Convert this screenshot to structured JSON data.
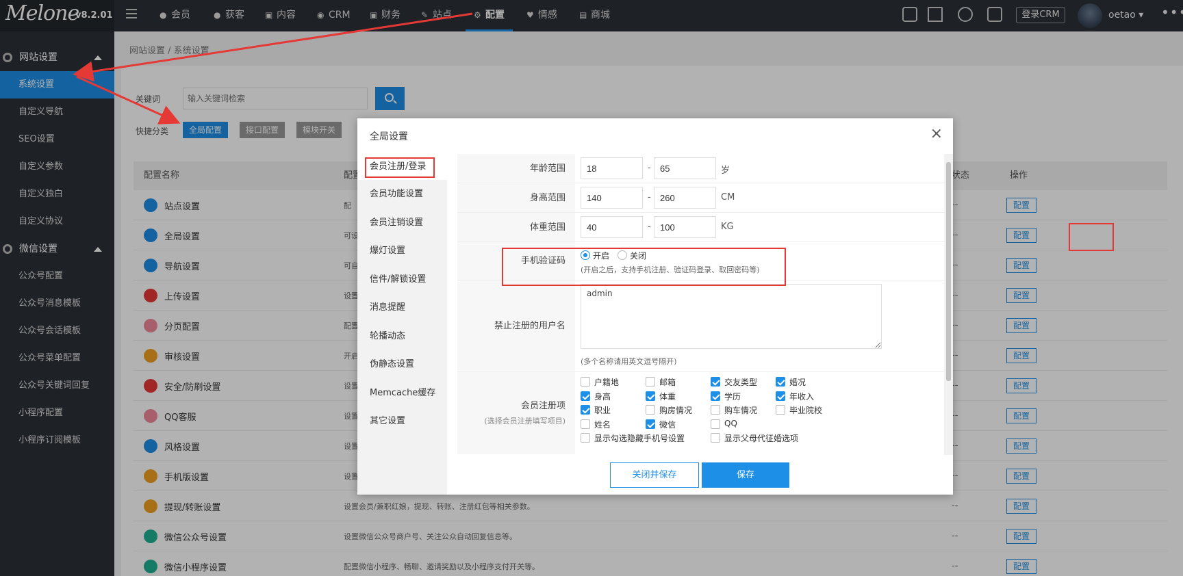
{
  "brand": {
    "logo_text": "Melone",
    "version": "v8.2.01"
  },
  "topnav": {
    "items": [
      {
        "label": "会员"
      },
      {
        "label": "获客"
      },
      {
        "label": "内容"
      },
      {
        "label": "CRM"
      },
      {
        "label": "财务"
      },
      {
        "label": "站点"
      },
      {
        "label": "配置",
        "active": true
      },
      {
        "label": "情感"
      },
      {
        "label": "商城"
      }
    ],
    "crm_login": "登录CRM",
    "username": "oetao"
  },
  "sidebar": {
    "groups": [
      {
        "title": "网站设置",
        "items": [
          "系统设置",
          "自定义导航",
          "SEO设置",
          "自定义参数",
          "自定义独白",
          "自定义协议"
        ]
      },
      {
        "title": "微信设置",
        "items": [
          "公众号配置",
          "公众号消息模板",
          "公众号会话模板",
          "公众号菜单配置",
          "公众号关键词回复",
          "小程序配置",
          "小程序订阅模板"
        ]
      }
    ],
    "active_item": "系统设置"
  },
  "breadcrumb": "网站设置 / 系统设置",
  "search": {
    "label": "关键词",
    "placeholder": "输入关键词检索"
  },
  "quick_filter": {
    "label": "快捷分类",
    "items": [
      "全局配置",
      "接口配置",
      "模块开关"
    ],
    "active": "全局配置"
  },
  "table": {
    "headers": {
      "name": "配置名称",
      "desc": "配置",
      "status": "状态",
      "action": "操作"
    },
    "rows": [
      {
        "name": "站点设置",
        "desc": "配",
        "status": "--",
        "action": "配置",
        "color": "#1e8fe6"
      },
      {
        "name": "全局设置",
        "desc": "可设",
        "status": "--",
        "action": "配置",
        "color": "#1e8fe6"
      },
      {
        "name": "导航设置",
        "desc": "可自",
        "status": "--",
        "action": "配置",
        "color": "#1e8fe6"
      },
      {
        "name": "上传设置",
        "desc": "设置",
        "status": "--",
        "action": "配置",
        "color": "#e53935"
      },
      {
        "name": "分页配置",
        "desc": "配置",
        "status": "--",
        "action": "配置",
        "color": "#ef8a9a"
      },
      {
        "name": "审核设置",
        "desc": "开启",
        "status": "--",
        "action": "配置",
        "color": "#f0a020"
      },
      {
        "name": "安全/防刷设置",
        "desc": "设置",
        "status": "--",
        "action": "配置",
        "color": "#e53935"
      },
      {
        "name": "QQ客服",
        "desc": "设置",
        "status": "--",
        "action": "配置",
        "color": "#ef8a9a"
      },
      {
        "name": "风格设置",
        "desc": "设置",
        "status": "--",
        "action": "配置",
        "color": "#1e8fe6"
      },
      {
        "name": "手机版设置",
        "desc": "设置",
        "status": "--",
        "action": "配置",
        "color": "#f0a020"
      },
      {
        "name": "提现/转账设置",
        "desc": "设置会员/兼职红娘，提现、转账、注册红包等相关参数。",
        "status": "--",
        "action": "配置",
        "color": "#f0a020"
      },
      {
        "name": "微信公众号设置",
        "desc": "设置微信公众号商户号、关注公众自动回复信息等。",
        "status": "--",
        "action": "配置",
        "color": "#20b090"
      },
      {
        "name": "微信小程序设置",
        "desc": "配置微信小程序、畅聊、邀请奖励以及小程序支付开关等。",
        "status": "--",
        "action": "配置",
        "color": "#20b090"
      }
    ]
  },
  "dialog": {
    "title": "全局设置",
    "close": "×",
    "tabs": [
      "会员注册/登录",
      "会员功能设置",
      "会员注销设置",
      "爆灯设置",
      "信件/解锁设置",
      "消息提醒",
      "轮播动态",
      "伪静态设置",
      "Memcache缓存",
      "其它设置"
    ],
    "active_tab": "会员注册/登录",
    "fields": {
      "age": {
        "label": "年龄范围",
        "min": "18",
        "max": "65",
        "unit": "岁",
        "sep": "-"
      },
      "height": {
        "label": "身高范围",
        "min": "140",
        "max": "260",
        "unit": "CM",
        "sep": "-"
      },
      "weight": {
        "label": "体重范围",
        "min": "40",
        "max": "100",
        "unit": "KG",
        "sep": "-"
      },
      "sms": {
        "label": "手机验证码",
        "on": "开启",
        "off": "关闭",
        "value": "开启",
        "hint": "(开启之后，支持手机注册、验证码登录、取回密码等)"
      },
      "banned": {
        "label": "禁止注册的用户名",
        "value": "admin",
        "hint": "(多个名称请用英文逗号隔开)"
      },
      "reg_items": {
        "label": "会员注册项",
        "sublabel": "(选择会员注册填写项目)",
        "options": [
          {
            "label": "户籍地",
            "checked": false
          },
          {
            "label": "邮箱",
            "checked": false
          },
          {
            "label": "交友类型",
            "checked": true
          },
          {
            "label": "婚况",
            "checked": true
          },
          {
            "label": "身高",
            "checked": true
          },
          {
            "label": "体重",
            "checked": true
          },
          {
            "label": "学历",
            "checked": true
          },
          {
            "label": "年收入",
            "checked": true
          },
          {
            "label": "职业",
            "checked": true
          },
          {
            "label": "购房情况",
            "checked": false
          },
          {
            "label": "购车情况",
            "checked": false
          },
          {
            "label": "毕业院校",
            "checked": false
          },
          {
            "label": "姓名",
            "checked": false
          },
          {
            "label": "微信",
            "checked": true
          },
          {
            "label": "QQ",
            "checked": false
          }
        ],
        "extra": [
          {
            "label": "显示勾选隐藏手机号设置",
            "checked": false
          },
          {
            "label": "显示父母代征婚选项",
            "checked": false
          }
        ]
      }
    },
    "buttons": {
      "close_save": "关闭并保存",
      "save": "保存"
    }
  },
  "colors": {
    "accent": "#1e8fe6",
    "dark": "#2b3036",
    "annotation": "#e53935"
  }
}
